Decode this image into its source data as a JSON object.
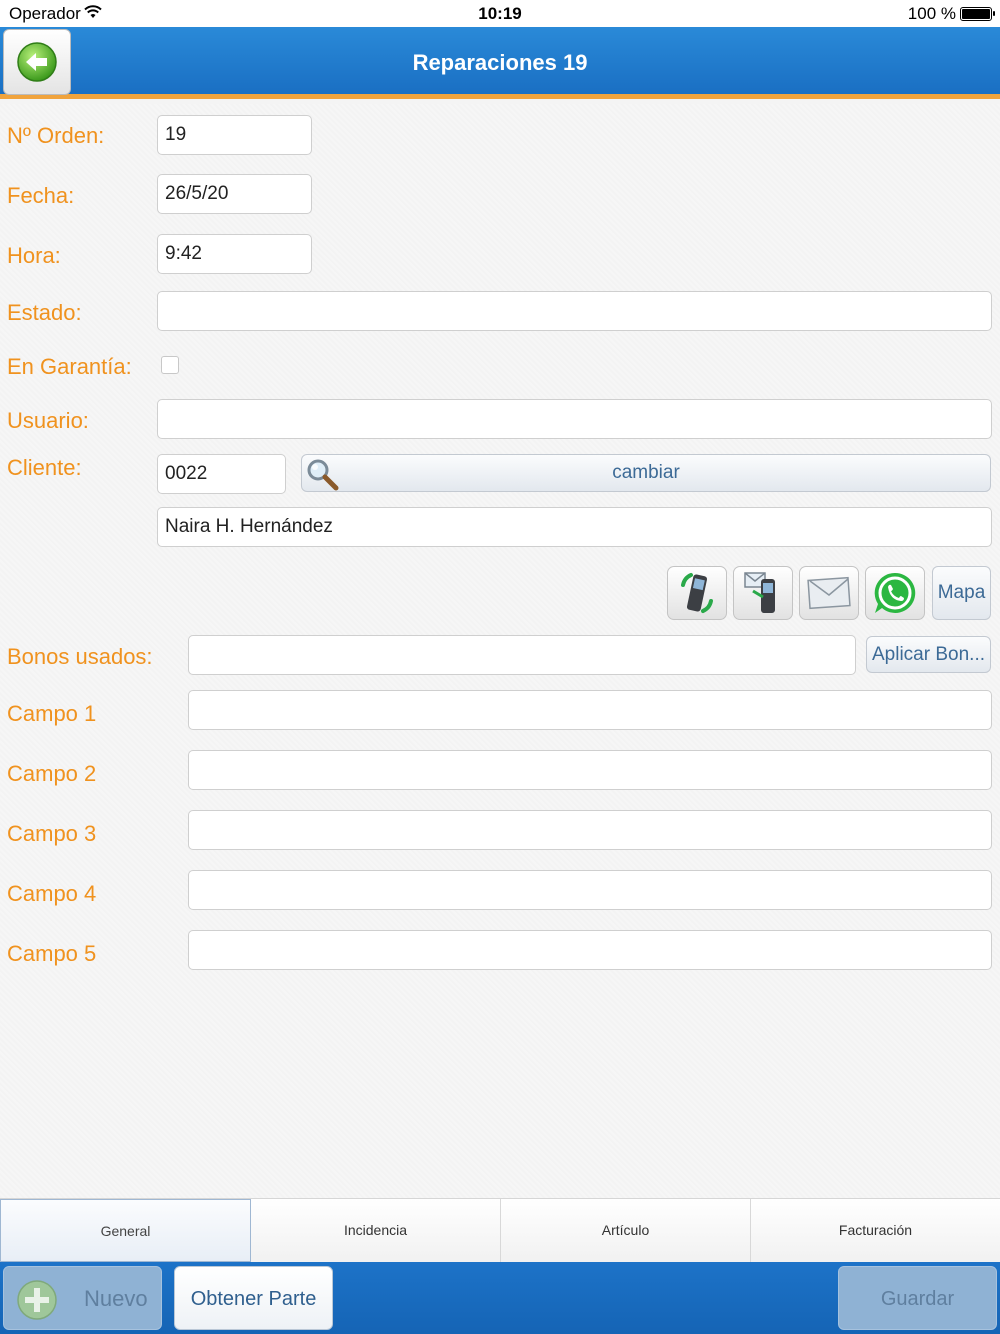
{
  "status_bar": {
    "carrier": "Operador",
    "time": "10:19",
    "battery": "100 %"
  },
  "nav": {
    "title": "Reparaciones 19"
  },
  "form": {
    "orden_label": "Nº Orden:",
    "orden_value": "19",
    "fecha_label": "Fecha:",
    "fecha_value": "26/5/20",
    "hora_label": "Hora:",
    "hora_value": "9:42",
    "estado_label": "Estado:",
    "estado_value": "",
    "garantia_label": "En Garantía:",
    "garantia_checked": false,
    "usuario_label": "Usuario:",
    "usuario_value": "",
    "cliente_label": "Cliente:",
    "cliente_code": "0022",
    "cambiar_label": "cambiar",
    "cliente_name": "Naira H. Hernández",
    "mapa_label": "Mapa",
    "bonos_label": "Bonos usados:",
    "bonos_value": "",
    "aplicar_label": "Aplicar Bon...",
    "campo1_label": "Campo 1",
    "campo1_value": "",
    "campo2_label": "Campo 2",
    "campo2_value": "",
    "campo3_label": "Campo 3",
    "campo3_value": "",
    "campo4_label": "Campo 4",
    "campo4_value": "",
    "campo5_label": "Campo 5",
    "campo5_value": ""
  },
  "tabs": [
    {
      "label": "General",
      "active": true
    },
    {
      "label": "Incidencia",
      "active": false
    },
    {
      "label": "Artículo",
      "active": false
    },
    {
      "label": "Facturación",
      "active": false
    }
  ],
  "toolbar": {
    "nuevo_label": "Nuevo",
    "obtener_label": "Obtener Parte",
    "guardar_label": "Guardar"
  },
  "colors": {
    "accent": "#f0921e",
    "nav_blue": "#1a6fc3",
    "nav_border": "#f0a33c"
  }
}
